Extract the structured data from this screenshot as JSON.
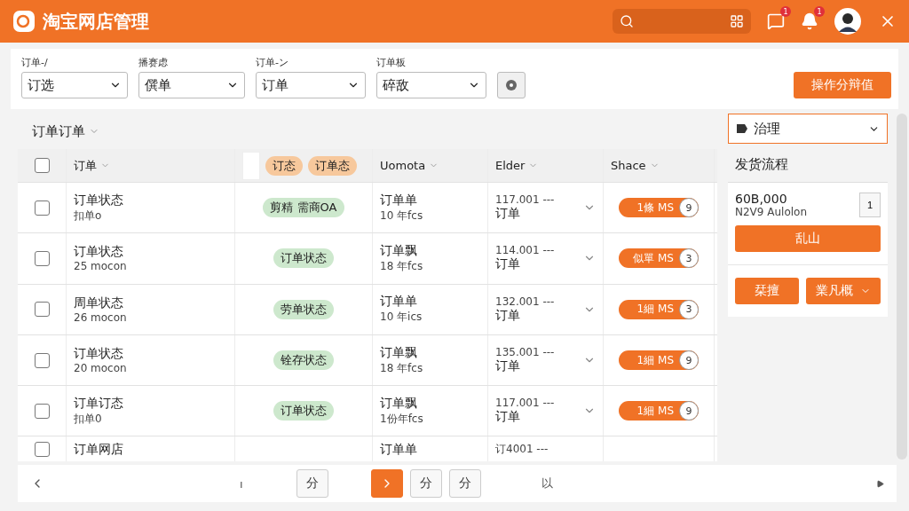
{
  "header": {
    "title": "淘宝网店管理",
    "message_badge": "1",
    "bell_badge": "1"
  },
  "filters": [
    {
      "label": "订单-/",
      "value": "订选"
    },
    {
      "label": "播赛虑",
      "value": "僎单"
    },
    {
      "label": "订单-ン",
      "value": "订单"
    },
    {
      "label": "订单板",
      "value": "碎敌"
    }
  ],
  "action_button": "操作分辩值",
  "table": {
    "title": "订单订单",
    "columns": [
      "订单",
      "Uomota",
      "Elder",
      "Shace"
    ],
    "status_tags": [
      "订态",
      "订单态"
    ],
    "all_checked": false,
    "rows": [
      {
        "checked": false,
        "name": "订单状态",
        "sub": "扣单o",
        "status": "剪精 需商OA",
        "qty": "订单单",
        "qty_sub": "10 年fcs",
        "price": "117.001 ---",
        "price_sub": "订单",
        "ship": "1條 MS",
        "ship_count": "9"
      },
      {
        "checked": false,
        "name": "订单状态",
        "sub": "25 mocon",
        "status": "订单状态",
        "qty": "订单飘",
        "qty_sub": "18 年fcs",
        "price": "114.001 ---",
        "price_sub": "订单",
        "ship": "似單 MS",
        "ship_count": "3"
      },
      {
        "checked": false,
        "name": "周单状态",
        "sub": "26 mocon",
        "status": "劳单状态",
        "qty": "订单单",
        "qty_sub": "10 年ics",
        "price": "132.001 ---",
        "price_sub": "订单",
        "ship": "1細 MS",
        "ship_count": "3"
      },
      {
        "checked": false,
        "name": "订单状态",
        "sub": "20 mocon",
        "status": "铨存状态",
        "qty": "订单飘",
        "qty_sub": "18 年fcs",
        "price": "135.001 ---",
        "price_sub": "订单",
        "ship": "1細 MS",
        "ship_count": "9"
      },
      {
        "checked": false,
        "name": "订单订态",
        "sub": "扣单0",
        "status": "订单状态",
        "qty": "订单飘",
        "qty_sub": "1份年fcs",
        "price": "117.001 ---",
        "price_sub": "订单",
        "ship": "1細 MS",
        "ship_count": "9"
      },
      {
        "checked": false,
        "name": "订单网店",
        "qty": "订单单",
        "price": "订4001 ---"
      }
    ]
  },
  "panel": {
    "select": "治理",
    "title": "发货流程",
    "amount": "60B,000",
    "sub": "N2V9 Aulolon",
    "side_button": "1",
    "primary_button": "乱山",
    "buttons": [
      "栞擅",
      "業凡概"
    ]
  },
  "pagination": [
    {
      "kind": "text",
      "label": "ı"
    },
    {
      "kind": "page",
      "label": "分",
      "selected": false
    },
    {
      "kind": "next",
      "selected": true
    },
    {
      "kind": "page",
      "label": "分",
      "selected": false
    },
    {
      "kind": "page",
      "label": "分",
      "selected": false
    },
    {
      "kind": "text",
      "label": "以"
    }
  ]
}
